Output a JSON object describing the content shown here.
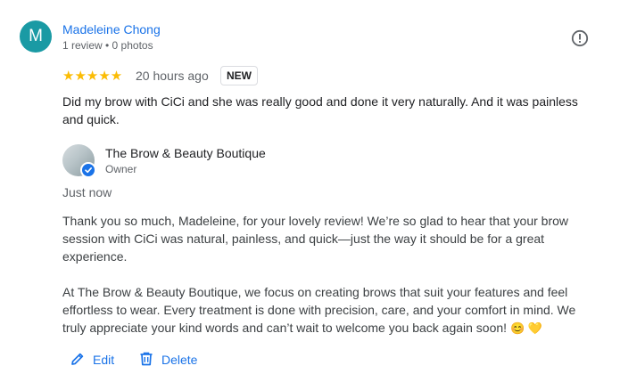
{
  "review": {
    "avatar_letter": "M",
    "reviewer_name": "Madeleine Chong",
    "reviewer_meta": "1 review • 0 photos",
    "stars": "★★★★★",
    "rating": 5,
    "time": "20 hours ago",
    "badge": "NEW",
    "text": "Did my brow with CiCi and she was really good and done it very naturally. And it was painless and quick."
  },
  "reply": {
    "owner_name": "The Brow & Beauty Boutique",
    "owner_role": "Owner",
    "time": "Just now",
    "paragraph_1": "Thank you so much, Madeleine, for your lovely review! We’re so glad to hear that your brow session with CiCi was natural, painless, and quick—just the way it should be for a great experience.",
    "paragraph_2": "At The Brow & Beauty Boutique, we focus on creating brows that suit your features and feel effortless to wear. Every treatment is done with precision, care, and your comfort in mind. We truly appreciate your kind words and can’t wait to welcome you back again soon!",
    "emojis": "😊 💛"
  },
  "actions": {
    "edit_label": "Edit",
    "delete_label": "Delete"
  },
  "colors": {
    "link_blue": "#1a73e8",
    "star_yellow": "#fbbc04",
    "avatar_teal": "#1a9aa4"
  },
  "icons": {
    "report": "exclamation-circle-icon",
    "verified": "verified-check-icon",
    "edit": "pencil-icon",
    "delete": "trash-icon"
  }
}
